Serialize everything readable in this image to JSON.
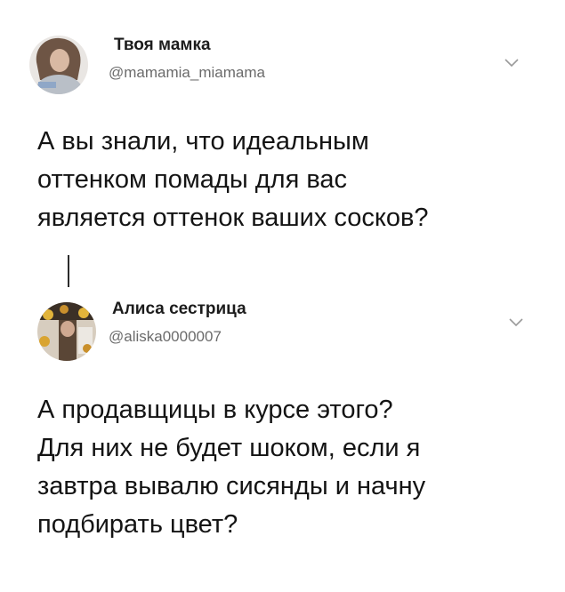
{
  "tweets": [
    {
      "display_name": "Твоя мамка",
      "handle": "@mamamia_miamama",
      "avatar_icon": "user-avatar-photo",
      "menu_icon": "chevron-down-icon",
      "body_lines": [
        "А вы знали, что идеальным",
        "оттенком помады для вас",
        "является оттенок ваших сосков?"
      ]
    },
    {
      "display_name": "Алиса сестрица",
      "handle": "@aliska0000007",
      "avatar_icon": "user-avatar-photo",
      "menu_icon": "chevron-down-icon",
      "body_lines": [
        "А продавщицы в курсе этого?",
        "Для них не будет шоком, если я",
        "завтра вывалю сисянды и начну",
        "подбирать цвет?"
      ]
    }
  ],
  "colors": {
    "text": "#141414",
    "handle": "#6b6b6b",
    "chevron": "#9a9a9a",
    "thread_line": "#2b2b2b"
  }
}
